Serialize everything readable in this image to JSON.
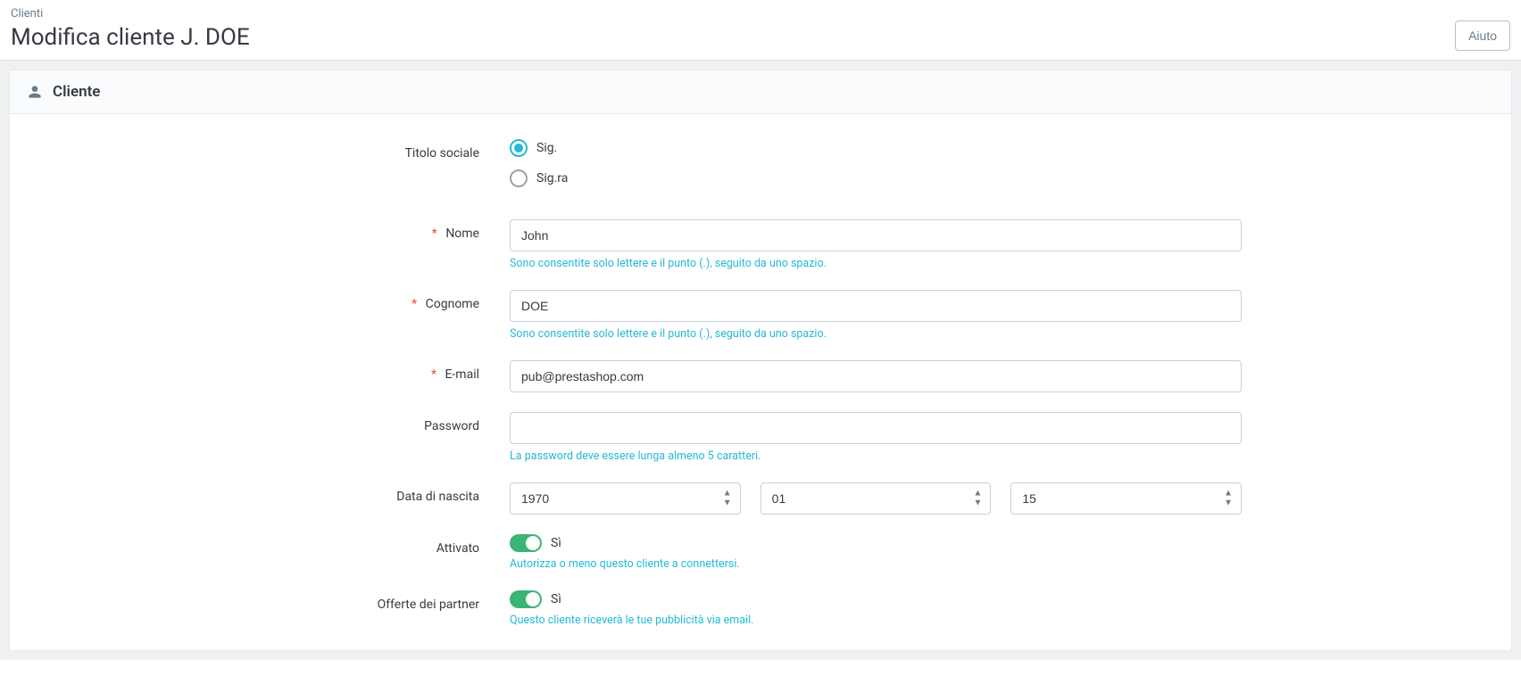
{
  "header": {
    "breadcrumb": "Clienti",
    "title": "Modifica cliente J. DOE",
    "help_label": "Aiuto"
  },
  "panel": {
    "title": "Cliente"
  },
  "fields": {
    "social_title": {
      "label": "Titolo sociale",
      "options": {
        "sig": "Sig.",
        "sigra": "Sig.ra"
      },
      "value": "sig"
    },
    "first_name": {
      "label": "Nome",
      "value": "John",
      "help": "Sono consentite solo lettere e il punto (.), seguito da uno spazio."
    },
    "last_name": {
      "label": "Cognome",
      "value": "DOE",
      "help": "Sono consentite solo lettere e il punto (.), seguito da uno spazio."
    },
    "email": {
      "label": "E-mail",
      "value": "pub@prestashop.com"
    },
    "password": {
      "label": "Password",
      "value": "",
      "help": "La password deve essere lunga almeno 5 caratteri."
    },
    "dob": {
      "label": "Data di nascita",
      "year": "1970",
      "month": "01",
      "day": "15"
    },
    "enabled": {
      "label": "Attivato",
      "value_label": "Sì",
      "help": "Autorizza o meno questo cliente a connettersi."
    },
    "partner_offers": {
      "label": "Offerte dei partner",
      "value_label": "Sì",
      "help": "Questo cliente riceverà le tue pubblicità via email."
    }
  }
}
